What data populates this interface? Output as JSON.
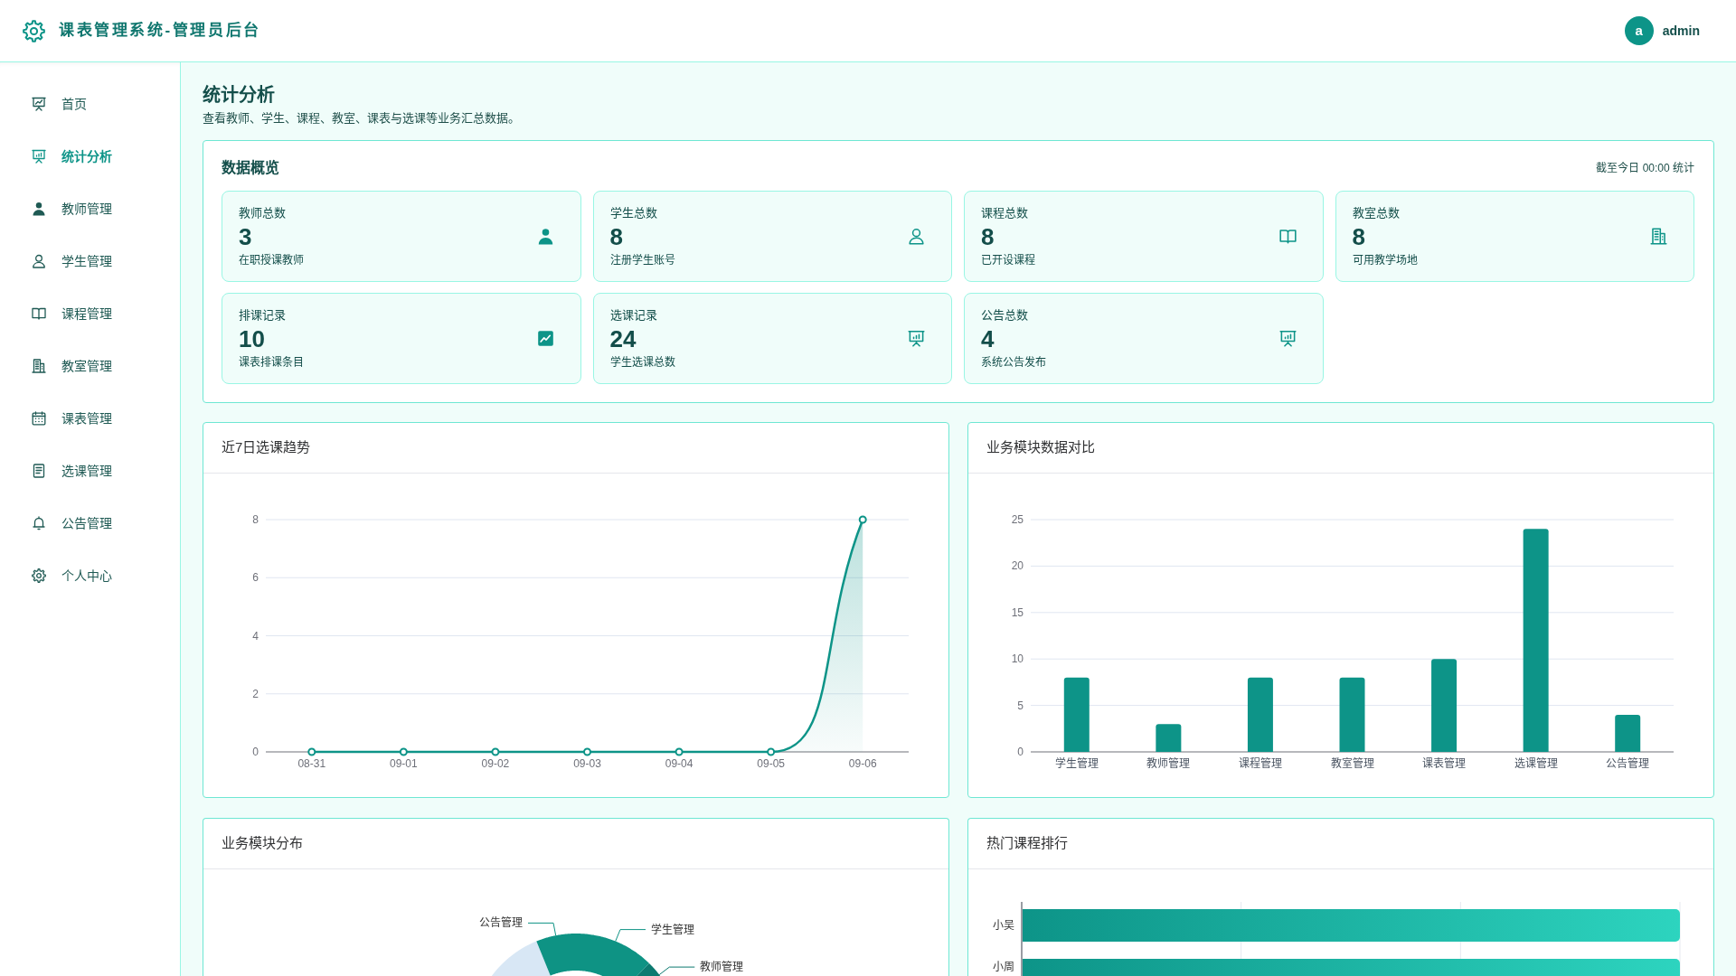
{
  "header": {
    "title": "课表管理系统-管理员后台",
    "user": {
      "avatar_letter": "a",
      "name": "admin"
    }
  },
  "sidebar": {
    "items": [
      {
        "label": "首页",
        "selected": false
      },
      {
        "label": "统计分析",
        "selected": true
      },
      {
        "label": "教师管理",
        "selected": false
      },
      {
        "label": "学生管理",
        "selected": false
      },
      {
        "label": "课程管理",
        "selected": false
      },
      {
        "label": "教室管理",
        "selected": false
      },
      {
        "label": "课表管理",
        "selected": false
      },
      {
        "label": "选课管理",
        "selected": false
      },
      {
        "label": "公告管理",
        "selected": false
      },
      {
        "label": "个人中心",
        "selected": false
      }
    ]
  },
  "page": {
    "title": "统计分析",
    "subtitle": "查看教师、学生、课程、教室、课表与选课等业务汇总数据。"
  },
  "overview": {
    "title": "数据概览",
    "note": "截至今日 00:00 统计",
    "stats": [
      {
        "label": "教师总数",
        "value": "3",
        "caption": "在职授课教师"
      },
      {
        "label": "学生总数",
        "value": "8",
        "caption": "注册学生账号"
      },
      {
        "label": "课程总数",
        "value": "8",
        "caption": "已开设课程"
      },
      {
        "label": "教室总数",
        "value": "8",
        "caption": "可用教学场地"
      },
      {
        "label": "排课记录",
        "value": "10",
        "caption": "课表排课条目"
      },
      {
        "label": "选课记录",
        "value": "24",
        "caption": "学生选课总数"
      },
      {
        "label": "公告总数",
        "value": "4",
        "caption": "系统公告发布"
      }
    ]
  },
  "trend_chart": {
    "title": "近7日选课趋势",
    "chart_data": {
      "type": "area",
      "categories": [
        "08-31",
        "09-01",
        "09-02",
        "09-03",
        "09-04",
        "09-05",
        "09-06"
      ],
      "values": [
        0,
        0,
        0,
        0,
        0,
        0,
        8
      ],
      "ylim": [
        0,
        8
      ],
      "yticks": [
        0,
        2,
        4,
        6,
        8
      ],
      "grid": true
    }
  },
  "module_chart": {
    "title": "业务模块数据对比",
    "chart_data": {
      "type": "bar",
      "categories": [
        "学生管理",
        "教师管理",
        "课程管理",
        "教室管理",
        "课表管理",
        "选课管理",
        "公告管理"
      ],
      "values": [
        8,
        3,
        8,
        8,
        10,
        24,
        4
      ],
      "ylim": [
        0,
        25
      ],
      "yticks": [
        0,
        5,
        10,
        15,
        20,
        25
      ],
      "grid": true
    }
  },
  "module_distribution": {
    "title": "业务模块分布",
    "labels": [
      "公告管理",
      "学生管理",
      "教师管理"
    ]
  },
  "course_ranking": {
    "title": "热门课程排行",
    "rows": [
      {
        "label": "小吴"
      },
      {
        "label": "小周"
      }
    ]
  }
}
